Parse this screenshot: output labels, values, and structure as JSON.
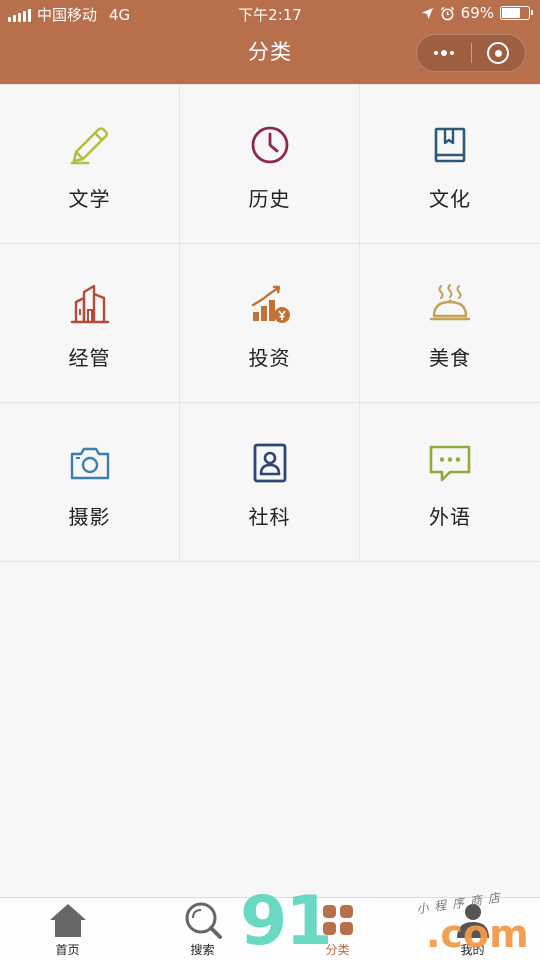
{
  "status_bar": {
    "carrier": "中国移动",
    "network": "4G",
    "time": "下午2:17",
    "battery_percent": "69%",
    "battery_level": 0.69
  },
  "nav": {
    "title": "分类",
    "menu_icon": "more-dots-icon",
    "close_icon": "target-circle-icon"
  },
  "categories": [
    {
      "label": "文学",
      "icon": "pencil-icon",
      "color": "#b5bd44"
    },
    {
      "label": "历史",
      "icon": "clock-icon",
      "color": "#8b2a4d"
    },
    {
      "label": "文化",
      "icon": "book-icon",
      "color": "#2d5878"
    },
    {
      "label": "经管",
      "icon": "buildings-icon",
      "color": "#b54b3b"
    },
    {
      "label": "投资",
      "icon": "growth-chart-icon",
      "color": "#c27334"
    },
    {
      "label": "美食",
      "icon": "food-cloche-icon",
      "color": "#c2a15a"
    },
    {
      "label": "摄影",
      "icon": "camera-icon",
      "color": "#3d7fa8"
    },
    {
      "label": "社科",
      "icon": "id-card-icon",
      "color": "#2b4575"
    },
    {
      "label": "外语",
      "icon": "chat-bubble-icon",
      "color": "#8cad3d"
    }
  ],
  "tabbar": {
    "items": [
      {
        "label": "首页",
        "icon": "home-icon"
      },
      {
        "label": "搜索",
        "icon": "search-icon"
      },
      {
        "label": "分类",
        "icon": "category-grid-icon",
        "active": true
      },
      {
        "label": "我的",
        "icon": "user-icon"
      }
    ]
  },
  "watermark": {
    "number": "91",
    "domain": ".com",
    "subtitle": "小程序商店"
  },
  "colors": {
    "header_bg": "#b86f4c",
    "page_bg": "#f7f7f7",
    "active_tab": "#b86f4c"
  }
}
